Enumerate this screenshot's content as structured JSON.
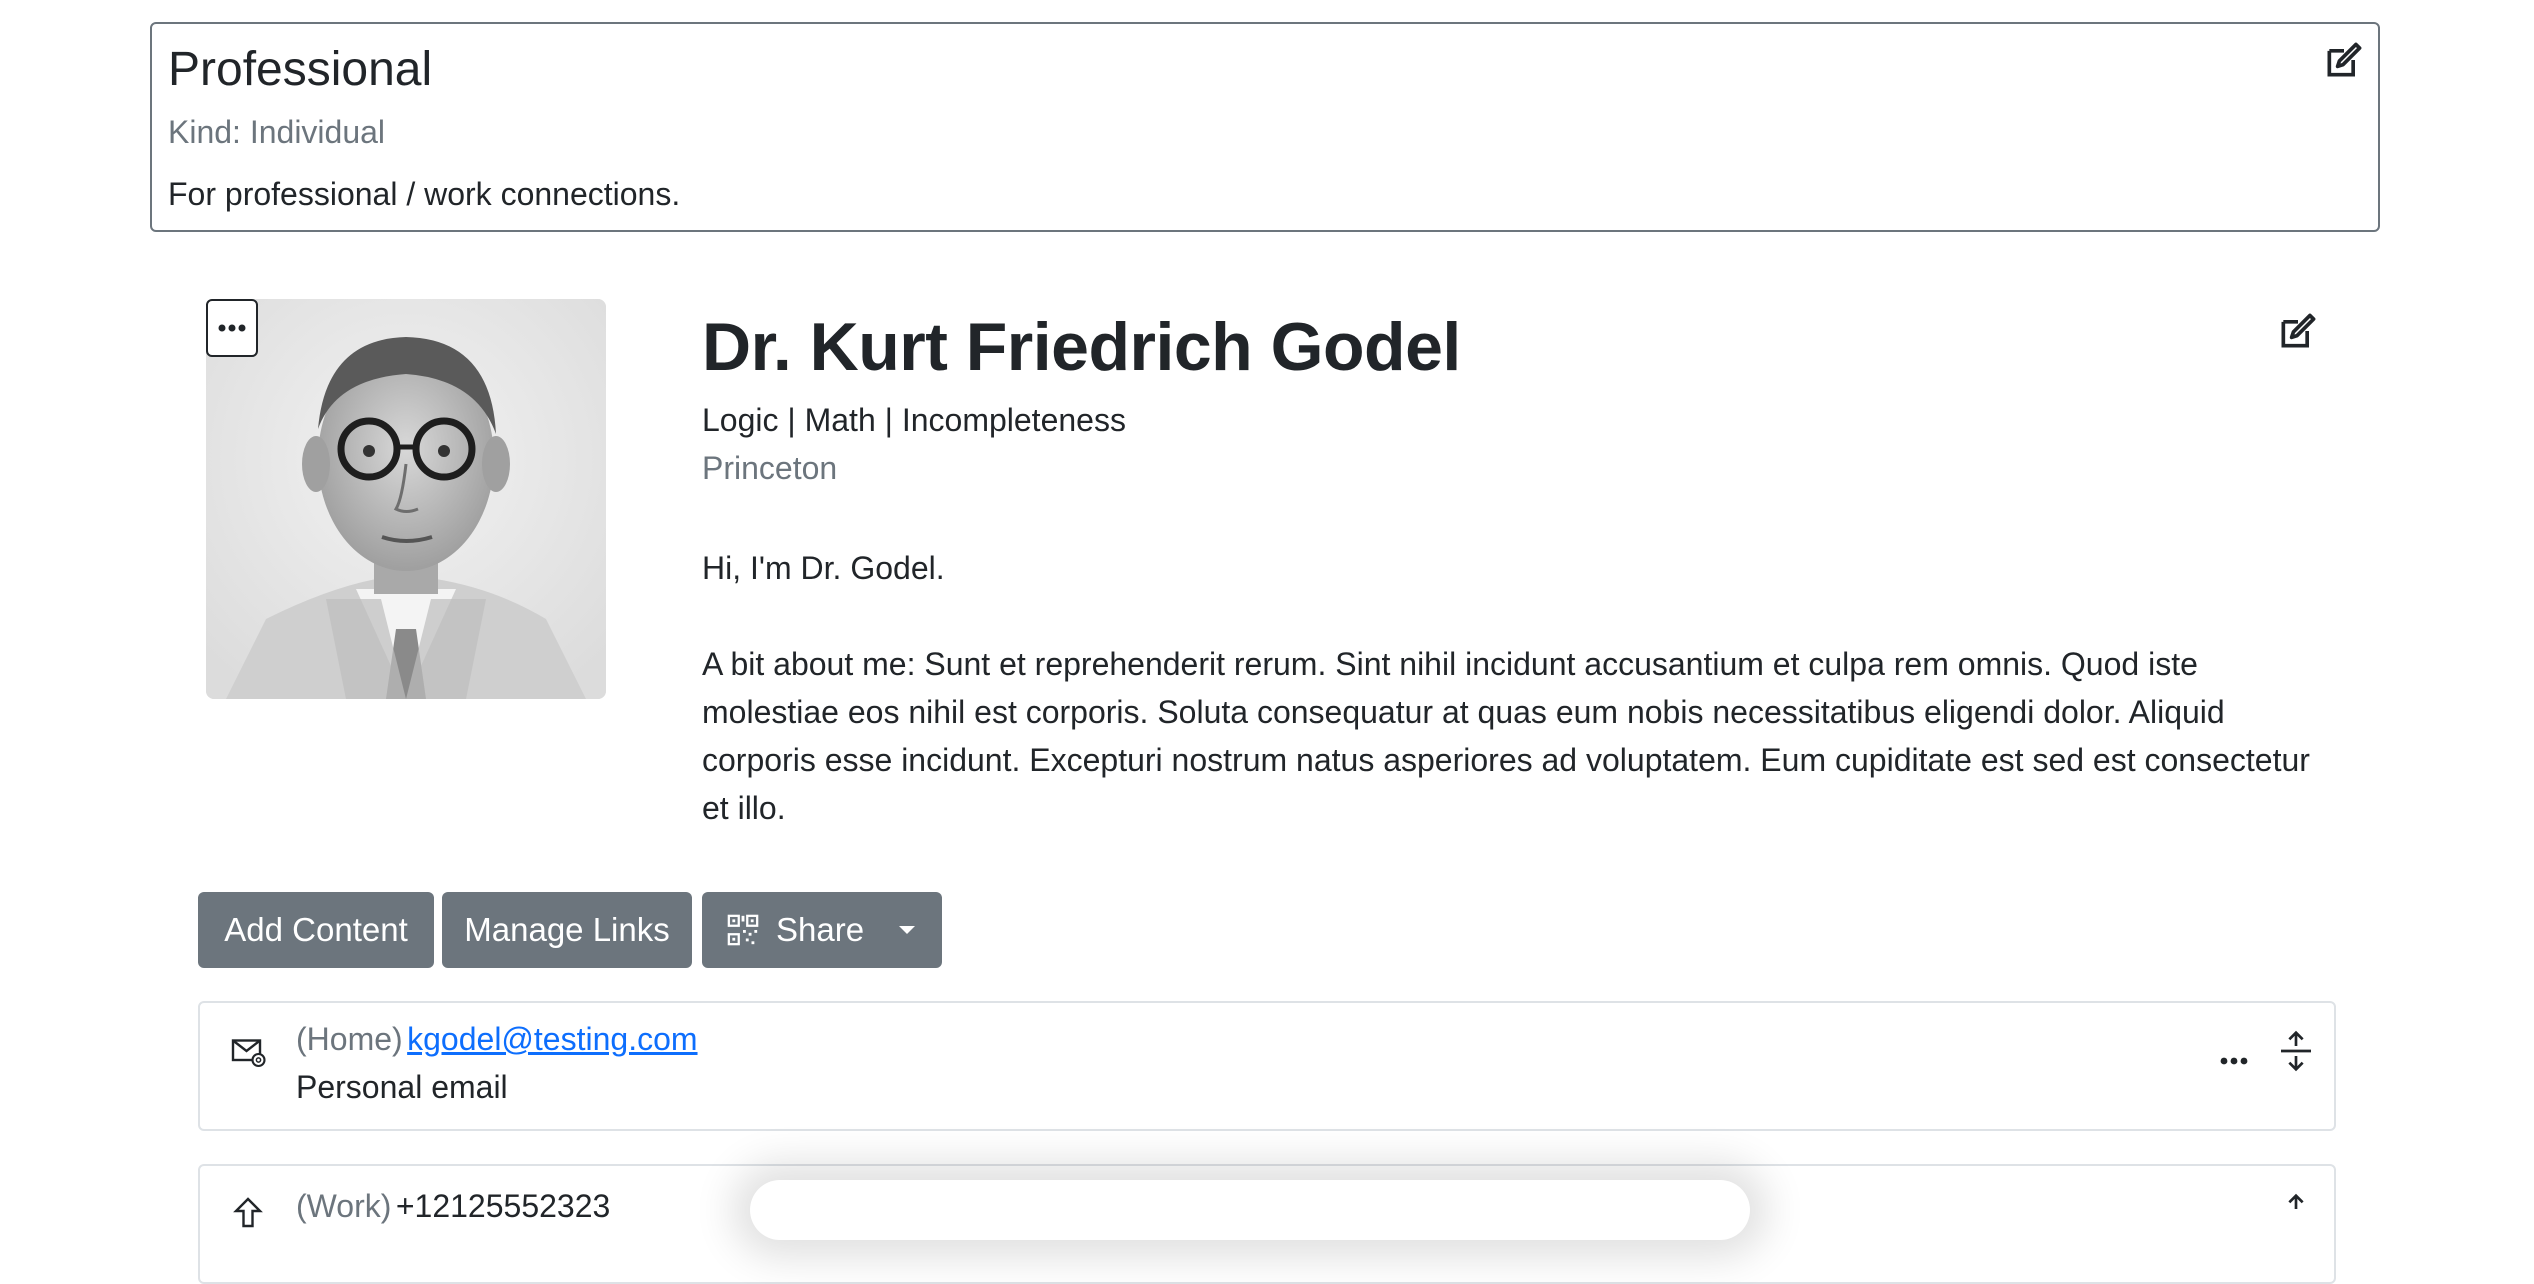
{
  "persona": {
    "title": "Professional",
    "kind_label": "Kind:",
    "kind_value": "Individual",
    "description": "For professional / work connections."
  },
  "profile": {
    "name": "Dr. Kurt Friedrich Godel",
    "tagline": "Logic | Math | Incompleteness",
    "organization": "Princeton",
    "bio_greeting": "Hi, I'm Dr. Godel.",
    "bio_about": "A bit about me: Sunt et reprehenderit rerum. Sint nihil incidunt accusantium et culpa rem omnis. Quod iste molestiae eos nihil est corporis. Soluta consequatur at quas eum nobis necessitatibus eligendi dolor. Aliquid corporis esse incidunt. Excepturi nostrum natus asperiores ad voluptatem. Eum cupiditate est sed est consectetur et illo."
  },
  "actions": {
    "add_content": "Add Content",
    "manage_links": "Manage Links",
    "share": "Share"
  },
  "items": [
    {
      "icon": "email-icon",
      "type": "(Home)",
      "value": "kgodel@testing.com",
      "description": "Personal email"
    },
    {
      "icon": "phone-icon",
      "type": "(Work)",
      "value": "+12125552323"
    }
  ],
  "colors": {
    "button_bg": "#6c757d",
    "link": "#0d6efd",
    "muted": "#6c757d",
    "text": "#212529"
  }
}
